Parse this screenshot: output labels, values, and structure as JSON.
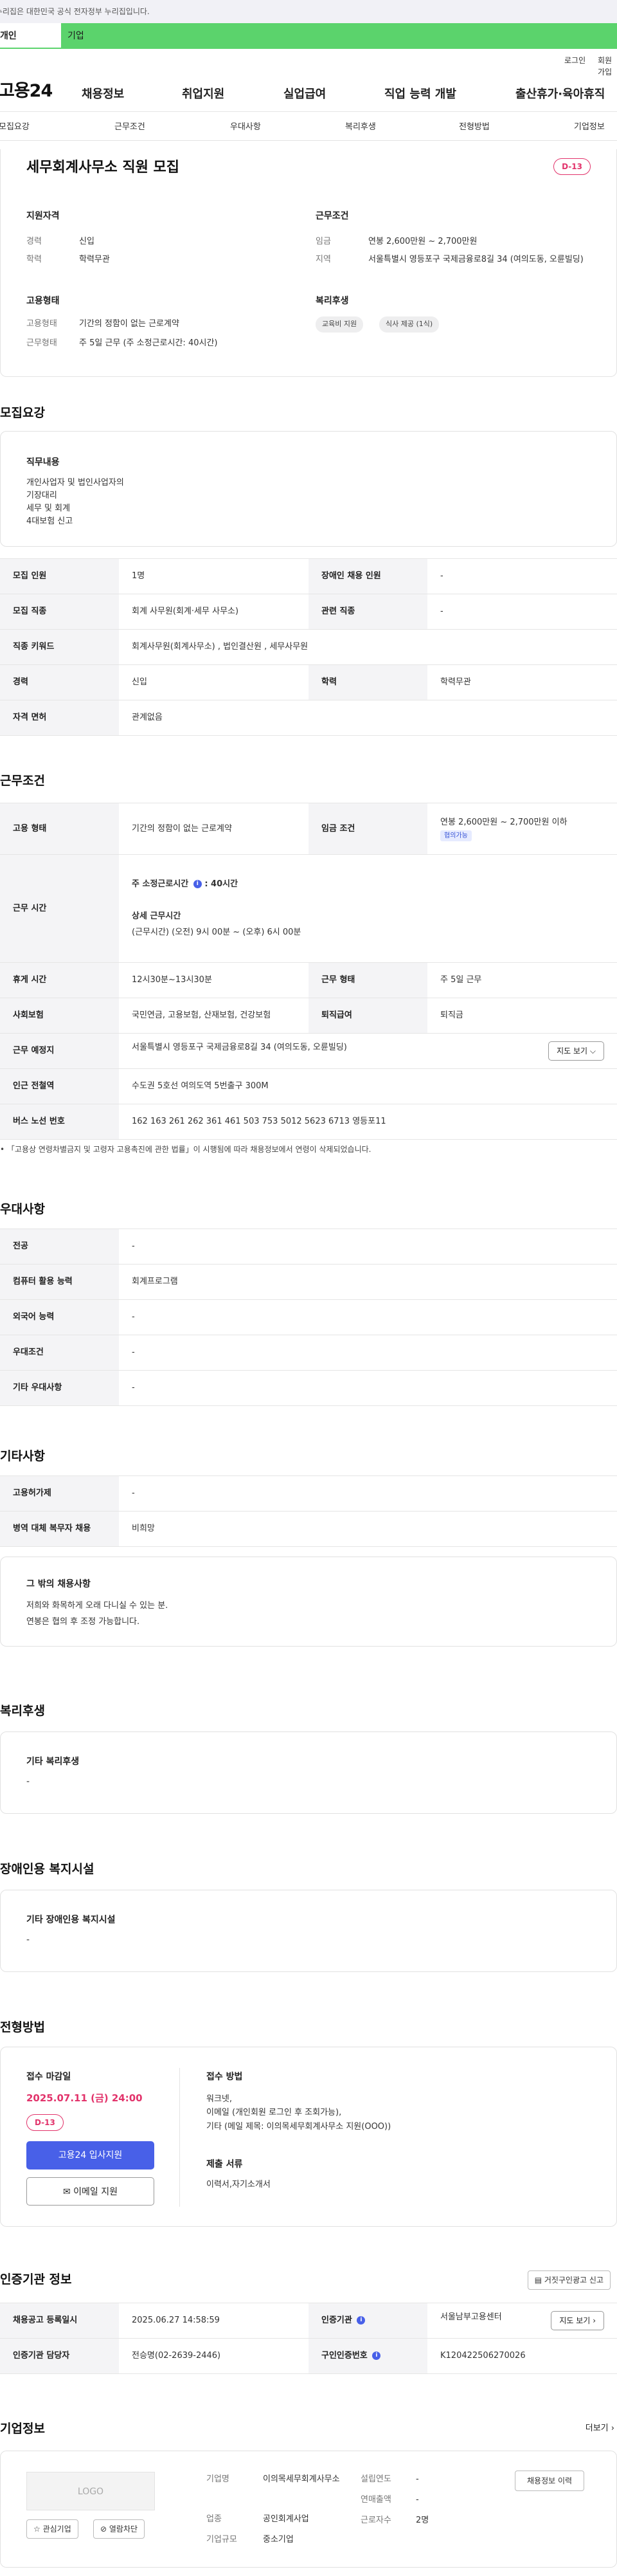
{
  "gov_banner": {
    "text": "이 누리집은 대한민국 공식 전자정부 누리집입니다."
  },
  "top_tabs": {
    "left": "개인",
    "right": "기업"
  },
  "util": {
    "login": "로그인",
    "join": "회원가입"
  },
  "logo": "고용24",
  "nav": [
    "채용정보",
    "취업지원",
    "실업급여",
    "직업 능력 개발",
    "출산휴가·육아휴직"
  ],
  "anchor_tabs": [
    "모집요강",
    "근무조건",
    "우대사항",
    "복리후생",
    "전형방법",
    "기업정보"
  ],
  "summary": {
    "title": "세무회계사무소 직원 모집",
    "dday": "D-13",
    "qual_title": "지원자격",
    "qual": [
      {
        "label": "경력",
        "value": "신입"
      },
      {
        "label": "학력",
        "value": "학력무관"
      }
    ],
    "cond_title": "근무조건",
    "cond": [
      {
        "label": "임금",
        "value": "연봉 2,600만원 ~ 2,700만원"
      },
      {
        "label": "지역",
        "value": "서울특별시 영등포구 국제금융로8길 34 (여의도동, 오륜빌딩)"
      }
    ],
    "emp_title": "고용형태",
    "emp": [
      {
        "label": "고용형태",
        "value": "기간의 정함이 없는 근로계약"
      },
      {
        "label": "근무형태",
        "value": "주 5일 근무 (주 소정근로시간: 40시간)"
      }
    ],
    "welfare_title": "복리후생",
    "welfare_chips": [
      "교육비 지원",
      "식사 제공 (1식)"
    ]
  },
  "recruit": {
    "title": "모집요강",
    "duty_title": "직무내용",
    "duty_lines": [
      "개인사업자 및 법인사업자의",
      "기장대리",
      "세무 및 회계",
      "4대보험 신고"
    ],
    "rows": [
      {
        "l1": "모집 인원",
        "v1": "1명",
        "l2": "장애인 채용 인원",
        "v2": "-"
      },
      {
        "l1": "모집 직종",
        "v1": "회계 사무원(회계·세무 사무소)",
        "l2": "관련 직종",
        "v2": "-"
      },
      {
        "l1": "직종 키워드",
        "v1": "회계사무원(회계사무소) , 법인결산원 , 세무사무원"
      },
      {
        "l1": "경력",
        "v1": "신입",
        "l2": "학력",
        "v2": "학력무관"
      },
      {
        "l1": "자격 면허",
        "v1": "관계없음"
      }
    ]
  },
  "work": {
    "title": "근무조건",
    "emp_type_label": "고용 형태",
    "emp_type": "기간의 정함이 없는 근로계약",
    "wage_label": "임금 조건",
    "wage": "연봉 2,600만원 ~ 2,700만원 이하",
    "wage_badge": "협의가능",
    "hours_label": "근무 시간",
    "hours_weekly_title": "주 소정근로시간",
    "hours_weekly": ": 40시간",
    "hours_detail_title": "상세 근무시간",
    "hours_detail": "(근무시간) (오전) 9시 00분 ~ (오후) 6시 00분",
    "break_label": "휴게 시간",
    "break": "12시30분~13시30분",
    "form_label": "근무 형태",
    "form": "주 5일 근무",
    "insurance_label": "사회보험",
    "insurance": "국민연금, 고용보험, 산재보험, 건강보험",
    "severance_label": "퇴직급여",
    "severance": "퇴직금",
    "place_label": "근무 예정지",
    "place": "서울특별시 영등포구 국제금융로8길 34 (여의도동, 오륜빌딩)",
    "map_btn": "지도 보기",
    "subway_label": "인근 전철역",
    "subway": "수도권 5호선 여의도역 5번출구 300M",
    "bus_label": "버스 노선 번호",
    "bus": "162 163 261 262 361 461 503 753 5012 5623 6713 영등포11",
    "note": "「고용상 연령차별금지 및 고령자 고용촉진에 관한 법률」이 시행됨에 따라 채용정보에서 연령이 삭제되었습니다."
  },
  "pref": {
    "title": "우대사항",
    "rows": [
      {
        "l": "전공",
        "v": "-"
      },
      {
        "l": "컴퓨터 활용 능력",
        "v": "회계프로그램"
      },
      {
        "l": "외국어 능력",
        "v": "-"
      },
      {
        "l": "우대조건",
        "v": "-"
      },
      {
        "l": "기타 우대사항",
        "v": "-"
      }
    ]
  },
  "etc": {
    "title": "기타사항",
    "rows": [
      {
        "l": "고용허가제",
        "v": "-"
      },
      {
        "l": "병역 대체 복무자 채용",
        "v": "비희망"
      }
    ],
    "box_title": "그 밖의 채용사항",
    "box_lines": [
      "저희와 화목하게 오래 다니실 수 있는 분.",
      "연봉은 협의 후 조정 가능합니다."
    ]
  },
  "welfare": {
    "title": "복리후생",
    "box_title": "기타 복리후생",
    "box_value": "-"
  },
  "disabled": {
    "title": "장애인용 복지시설",
    "box_title": "기타 장애인용 복지시설",
    "box_value": "-"
  },
  "process": {
    "title": "전형방법",
    "deadline_title": "접수 마감일",
    "deadline": "2025.07.11 (금) 24:00",
    "dday": "D-13",
    "apply_btn": "고용24 입사지원",
    "email_btn": "이메일 지원",
    "method_title": "접수 방법",
    "method_lines": [
      "워크넷,",
      "이메일 (개인회원 로그인 후 조회가능),",
      "기타 (메일 제목: 이의목세무회계사무소 지원(OOO))"
    ],
    "docs_title": "제출 서류",
    "docs": "이력서,자기소개서"
  },
  "cert": {
    "title": "인증기관 정보",
    "report_btn": "거짓구인광고 신고",
    "reg_label": "채용공고 등록일시",
    "reg": "2025.06.27 14:58:59",
    "agency_label": "인증기관",
    "agency": "서울남부고용센터",
    "map_btn": "지도 보기",
    "manager_label": "인증기관 담당자",
    "manager": "전승명(02-2639-2446)",
    "no_label": "구인인증번호",
    "no": "K120422506270026"
  },
  "company": {
    "title": "기업정보",
    "more": "더보기",
    "logo_text": "LOGO",
    "fav_btn": "관심기업",
    "block_btn": "열람차단",
    "name_label": "기업명",
    "name": "이의목세무회계사무소",
    "industry_label": "업종",
    "industry": "공인회계사업",
    "size_label": "기업규모",
    "size": "중소기업",
    "year_label": "설립연도",
    "year": "-",
    "sales_label": "연매출액",
    "sales": "-",
    "staff_label": "근로자수",
    "staff": "2명",
    "jobs_btn": "채용정보 이력"
  }
}
